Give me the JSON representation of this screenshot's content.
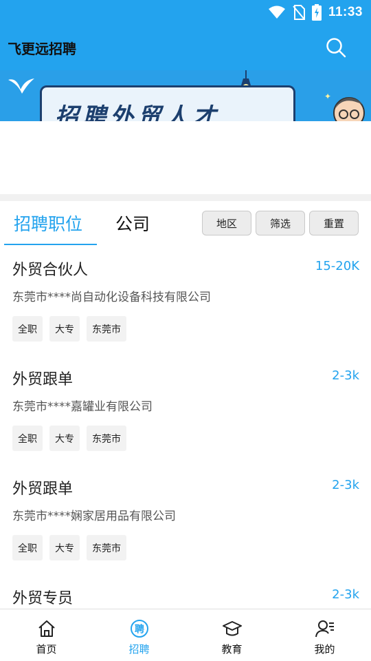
{
  "status_bar": {
    "time": "11:33"
  },
  "header": {
    "title": "飞更远招聘"
  },
  "banner": {
    "text": "招聘外贸人才"
  },
  "tabs": {
    "jobs": "招聘职位",
    "company": "公司"
  },
  "filters": {
    "region": "地区",
    "filter": "筛选",
    "reset": "重置"
  },
  "jobs": [
    {
      "title": "外贸合伙人",
      "salary": "15-20K",
      "company": "东莞市****尚自动化设备科技有限公司",
      "tags": [
        "全职",
        "大专",
        "东莞市"
      ]
    },
    {
      "title": "外贸跟单",
      "salary": "2-3k",
      "company": "东莞市****嘉罐业有限公司",
      "tags": [
        "全职",
        "大专",
        "东莞市"
      ]
    },
    {
      "title": "外贸跟单",
      "salary": "2-3k",
      "company": "东莞市****娴家居用品有限公司",
      "tags": [
        "全职",
        "大专",
        "东莞市"
      ]
    },
    {
      "title": "外贸专员",
      "salary": "2-3k",
      "company": "",
      "tags": []
    }
  ],
  "nav": [
    {
      "label": "首页",
      "icon": "home-icon"
    },
    {
      "label": "招聘",
      "icon": "recruit-icon"
    },
    {
      "label": "教育",
      "icon": "graduation-cap-icon"
    },
    {
      "label": "我的",
      "icon": "profile-icon"
    }
  ],
  "colors": {
    "accent": "#23a3ee",
    "header": "#23a3ee"
  }
}
